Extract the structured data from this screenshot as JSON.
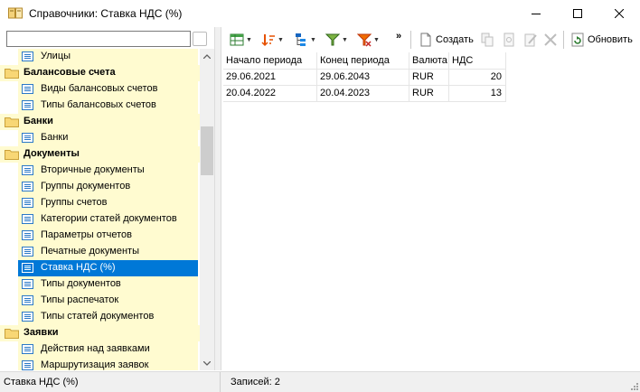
{
  "window": {
    "title": "Справочники: Ставка НДС (%)"
  },
  "left": {
    "search_value": "",
    "tree": [
      {
        "type": "item",
        "label": "Улицы",
        "selected": false
      },
      {
        "type": "group",
        "label": "Балансовые счета"
      },
      {
        "type": "item",
        "label": "Виды балансовых счетов",
        "selected": false
      },
      {
        "type": "item",
        "label": "Типы балансовых счетов",
        "selected": false
      },
      {
        "type": "group",
        "label": "Банки"
      },
      {
        "type": "item",
        "label": "Банки",
        "selected": false
      },
      {
        "type": "group",
        "label": "Документы"
      },
      {
        "type": "item",
        "label": "Вторичные документы",
        "selected": false
      },
      {
        "type": "item",
        "label": "Группы документов",
        "selected": false
      },
      {
        "type": "item",
        "label": "Группы счетов",
        "selected": false
      },
      {
        "type": "item",
        "label": "Категории статей документов",
        "selected": false
      },
      {
        "type": "item",
        "label": "Параметры отчетов",
        "selected": false
      },
      {
        "type": "item",
        "label": "Печатные документы",
        "selected": false
      },
      {
        "type": "item",
        "label": "Ставка НДС (%)",
        "selected": true
      },
      {
        "type": "item",
        "label": "Типы документов",
        "selected": false
      },
      {
        "type": "item",
        "label": "Типы распечаток",
        "selected": false
      },
      {
        "type": "item",
        "label": "Типы статей документов",
        "selected": false
      },
      {
        "type": "group",
        "label": "Заявки"
      },
      {
        "type": "item",
        "label": "Действия над заявками",
        "selected": false
      },
      {
        "type": "item",
        "label": "Маршрутизация заявок",
        "selected": false
      }
    ]
  },
  "toolbar": {
    "more": "»",
    "create_label": "Создать",
    "refresh_label": "Обновить"
  },
  "grid": {
    "columns": [
      "Начало периода",
      "Конец периода",
      "Валюта",
      "НДС"
    ],
    "rows": [
      [
        "29.06.2021",
        "29.06.2043",
        "RUR",
        "20"
      ],
      [
        "20.04.2022",
        "20.04.2023",
        "RUR",
        "13"
      ]
    ]
  },
  "status": {
    "left": "Ставка НДС (%)",
    "right": "Записей: 2"
  },
  "colors": {
    "group_bg": "#fffbd0",
    "selection": "#0078d7",
    "accent_blue": "#2b79c7"
  }
}
